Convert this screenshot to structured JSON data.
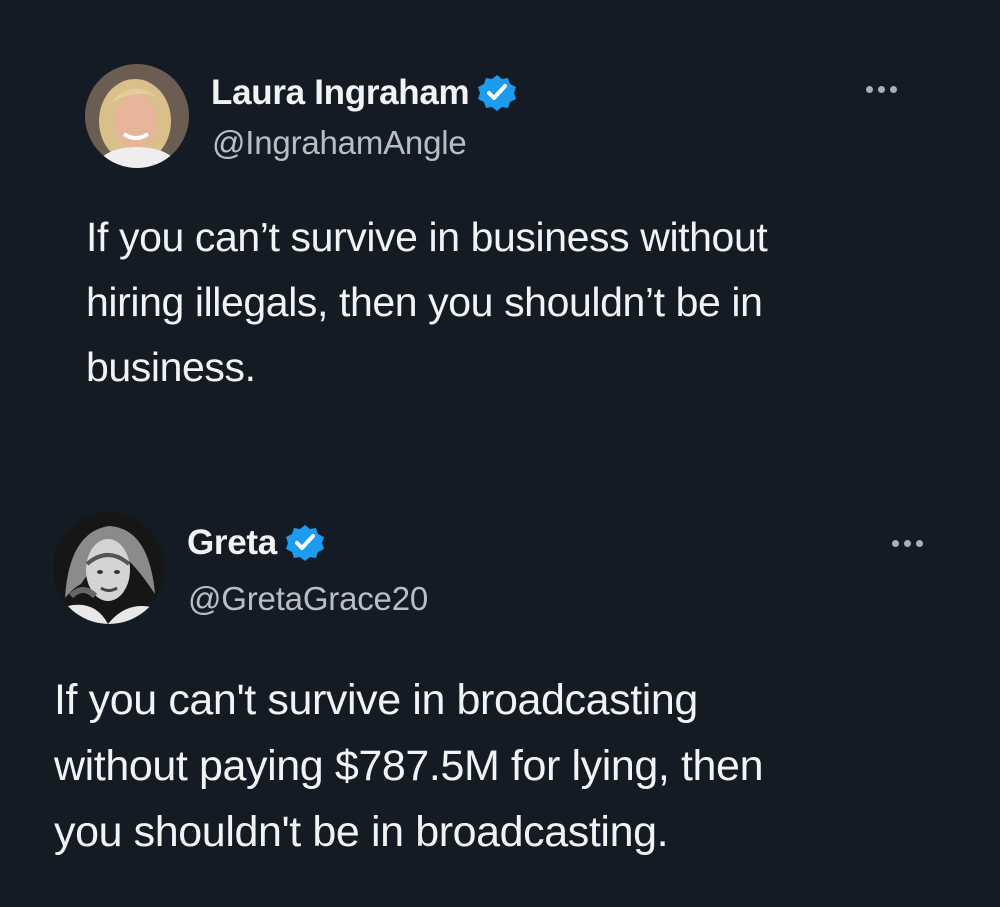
{
  "tweets": [
    {
      "author": {
        "display_name": "Laura Ingraham",
        "handle": "@IngrahamAngle",
        "verified": true,
        "avatar": "profile-photo-blonde-woman"
      },
      "more_icon": "more-options-icon",
      "text": "If you can’t survive in business without\nhiring illegals, then you shouldn’t be in\nbusiness."
    },
    {
      "author": {
        "display_name": "Greta",
        "handle": "@GretaGrace20",
        "verified": true,
        "avatar": "profile-photo-black-and-white-portrait"
      },
      "more_icon": "more-options-icon",
      "text": "If you can't survive in broadcasting\nwithout paying $787.5M for lying, then\nyou shouldn't be in broadcasting."
    }
  ],
  "colors": {
    "background": "#151b25",
    "text_primary": "#f2f3f4",
    "text_secondary": "#b8bec4",
    "verified_badge": "#1d9bf0"
  }
}
